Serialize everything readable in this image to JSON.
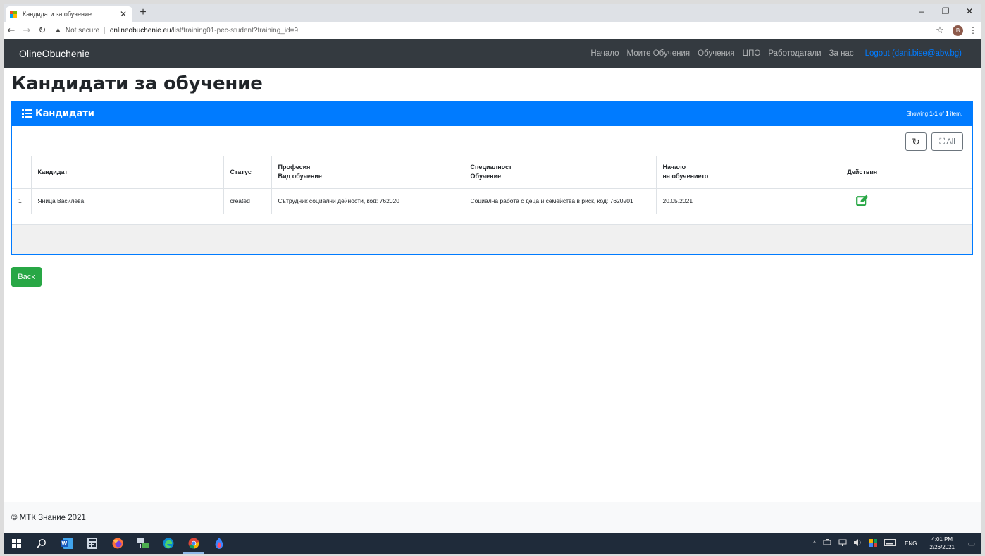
{
  "browser": {
    "tab_title": "Кандидати за обучение",
    "tab_close": "✕",
    "new_tab": "+",
    "win_minimize": "–",
    "win_restore": "❐",
    "win_close": "✕",
    "back": "←",
    "forward": "→",
    "reload": "↻",
    "security_icon": "▲",
    "security_text": "Not secure",
    "separator": "|",
    "url_host": "onlineobuchenie.eu",
    "url_path": "/list/training01-pec-student?training_id=9",
    "star": "☆",
    "profile_initial": "B",
    "menu": "⋮"
  },
  "navbar": {
    "brand": "OlineObuchenie",
    "links": [
      "Начало",
      "Моите Обучения",
      "Обучения",
      "ЦПО",
      "Работодатали",
      "За нас"
    ],
    "logout": "Logout (dani.bise@abv.bg)"
  },
  "page": {
    "title": "Кандидати за обучение"
  },
  "card": {
    "header": "Кандидати",
    "summary_prefix": "Showing ",
    "summary_range": "1-1",
    "summary_mid": " of ",
    "summary_total": "1",
    "summary_suffix": " item.",
    "refresh_icon": "↻",
    "all_label": "⛶ All",
    "columns": {
      "candidate": "Кандидат",
      "status": "Статус",
      "profession_1": "Професия",
      "profession_2": "Вид обучение",
      "specialty_1": "Специалност",
      "specialty_2": "Обучение",
      "start_1": "Начало",
      "start_2": "на обучението",
      "actions": "Действия"
    },
    "rows": [
      {
        "num": "1",
        "candidate": "Яница Василева",
        "status": "created",
        "profession": "Сътрудник социални дейности, код: 762020",
        "specialty": "Социална работа с деца и семейства в риск, код: 7620201",
        "start": "20.05.2021"
      }
    ]
  },
  "back_button": "Back",
  "footer": "© МТК Знание 2021",
  "taskbar": {
    "tray_chevron": "^",
    "lang": "ENG",
    "time": "4:01 PM",
    "date": "2/26/2021",
    "notifications": "▭"
  },
  "colors": {
    "primary": "#007bff",
    "success": "#28a745",
    "navbar_bg": "#343a40",
    "edit_icon": "#28a745"
  }
}
